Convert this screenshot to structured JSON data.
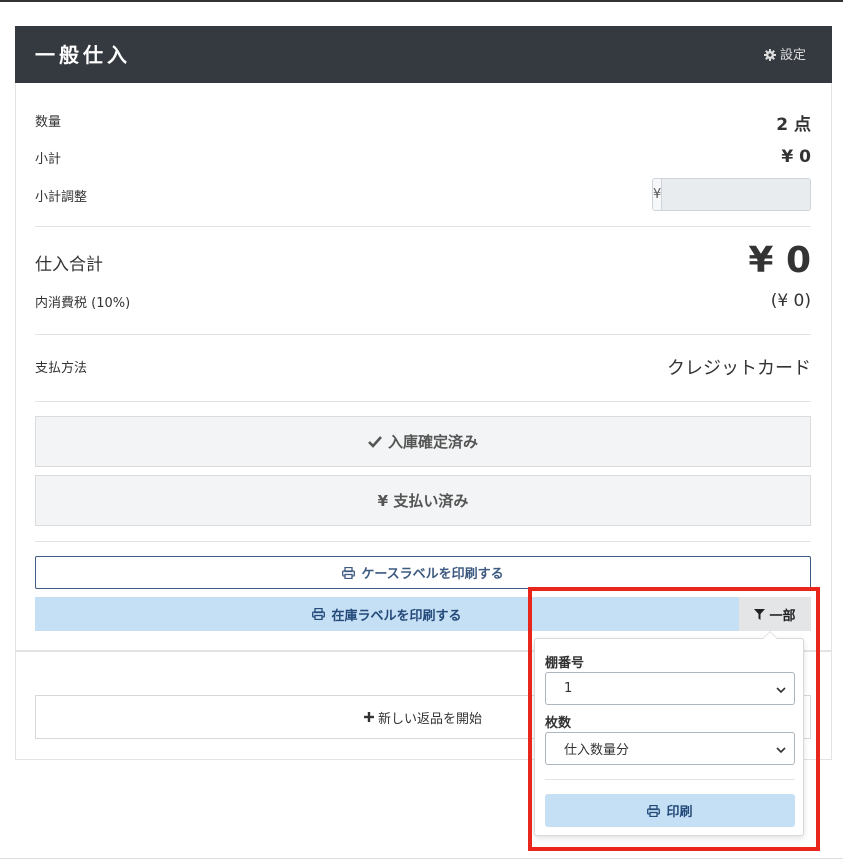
{
  "header": {
    "title": "一般仕入",
    "settings_label": "設定"
  },
  "summary": {
    "quantity_label": "数量",
    "quantity_value": "2 点",
    "subtotal_label": "小計",
    "subtotal_value": "¥ 0",
    "adjustment_label": "小計調整",
    "adjustment_addon": "¥",
    "adjustment_value": ""
  },
  "total": {
    "label": "仕入合計",
    "value": "¥ 0",
    "tax_label": "内消費税 (10%)",
    "tax_value": "(¥ 0)"
  },
  "payment": {
    "label": "支払方法",
    "value": "クレジットカード"
  },
  "status": {
    "stock_confirmed": "入庫確定済み",
    "paid": "¥ 支払い済み"
  },
  "print": {
    "case_label_button": "ケースラベルを印刷する",
    "stock_label_button": "在庫ラベルを印刷する",
    "partial_toggle": "一部"
  },
  "dropdown": {
    "shelf_label": "棚番号",
    "shelf_value": "1",
    "count_label": "枚数",
    "count_value": "仕入数量分",
    "print_button": "印刷"
  },
  "returns": {
    "new_return_button": "新しい返品を開始"
  },
  "colors": {
    "header_bg": "#343a40",
    "primary_light": "#c5dff5",
    "highlight": "#e8261c"
  }
}
